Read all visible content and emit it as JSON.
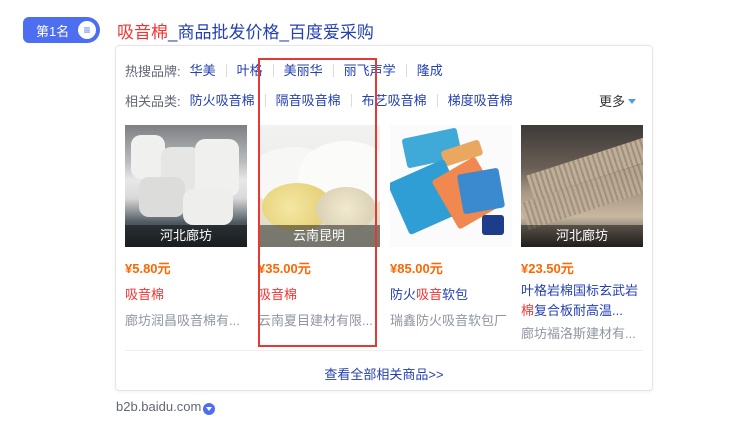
{
  "result": {
    "rank_label": "第1名",
    "title_highlight": "吸音棉",
    "title_rest": "_商品批发价格_百度爱采购",
    "source": "b2b.baidu.com"
  },
  "filters": {
    "brand_label": "热搜品牌:",
    "brands": [
      "华美",
      "叶格",
      "美丽华",
      "丽飞声学",
      "隆成"
    ],
    "category_label": "相关品类:",
    "categories": [
      "防火吸音棉",
      "隔音吸音棉",
      "布艺吸音棉",
      "梯度吸音棉"
    ],
    "more_label": "更多"
  },
  "products": [
    {
      "location": "河北廊坊",
      "price": "¥5.80元",
      "name": "吸音棉",
      "seller": "廊坊润昌吸音棉有..."
    },
    {
      "location": "云南昆明",
      "price": "¥35.00元",
      "name": "吸音棉",
      "seller": "云南夏目建材有限..."
    },
    {
      "location": "",
      "price": "¥85.00元",
      "name_blue1": "防火",
      "name_red": "吸音",
      "name_blue2": "软包",
      "seller": "瑞鑫防火吸音软包厂"
    },
    {
      "location": "河北廊坊",
      "price": "¥23.50元",
      "name_line1": "叶格岩棉国标玄武岩",
      "name_hl": "棉",
      "name_line2": "复合板耐高温...",
      "seller": "廊坊福洛斯建材有..."
    }
  ],
  "view_all_label": "查看全部相关商品>>",
  "colors": {
    "accent": "#4e6ef2",
    "link": "#2440b3",
    "highlight": "#f73131",
    "price": "#ff6600",
    "annotation_box": "#e53935"
  }
}
